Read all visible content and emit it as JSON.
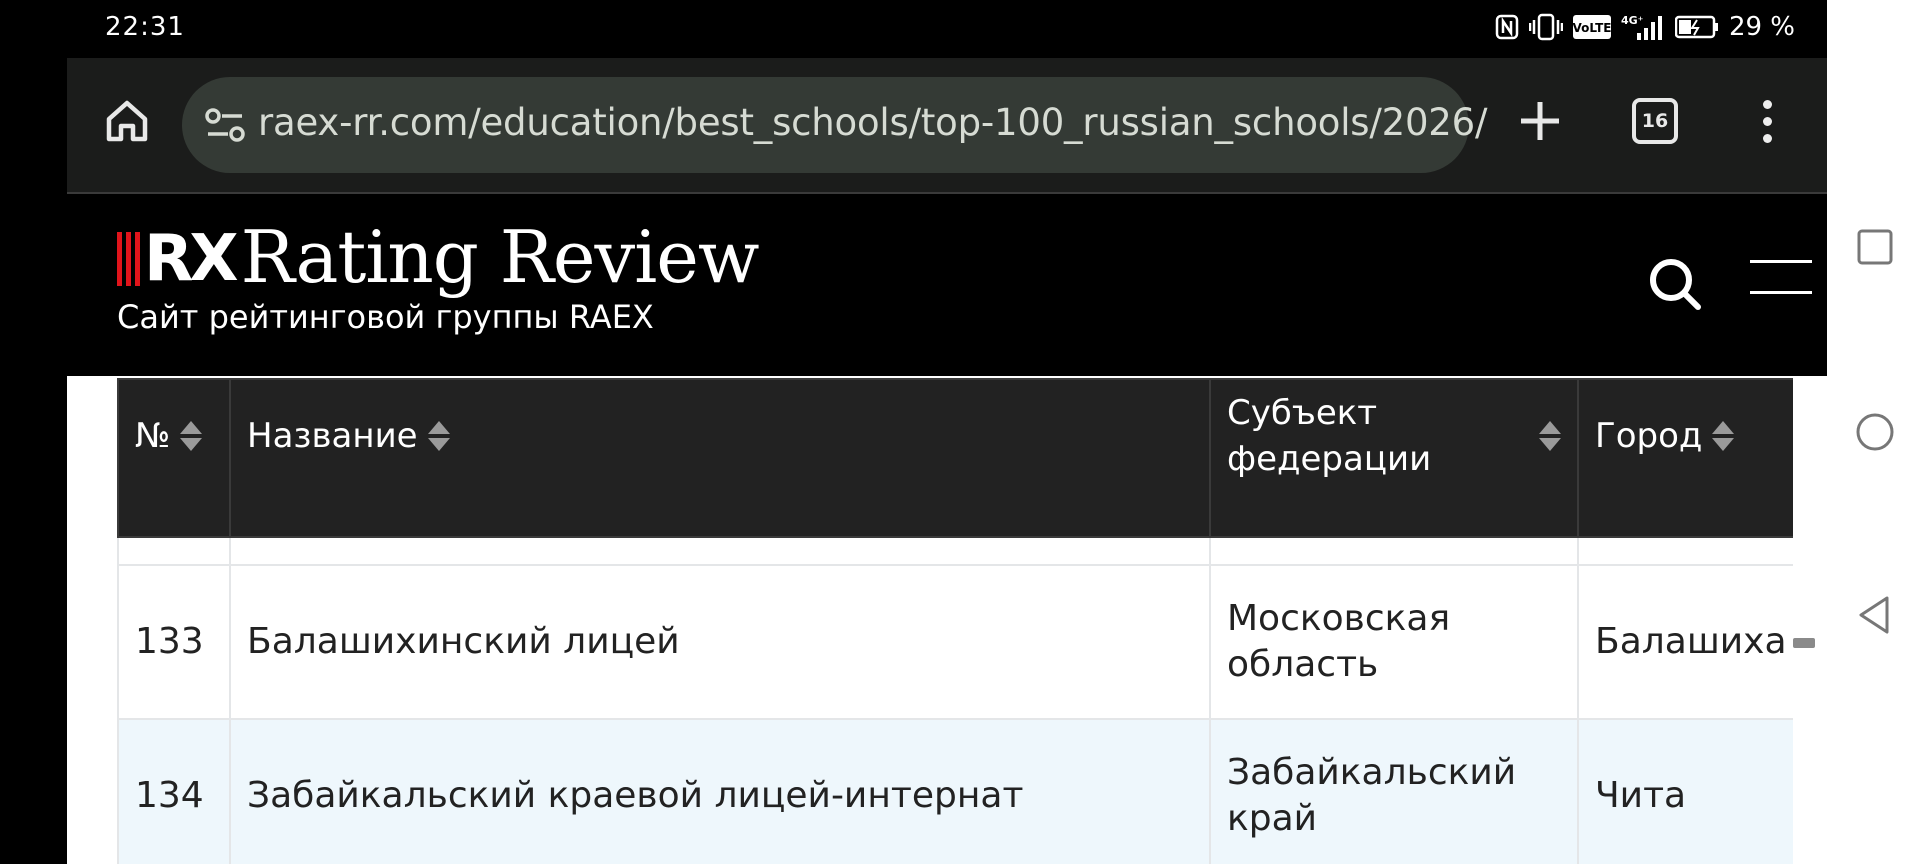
{
  "status_bar": {
    "time": "22:31",
    "battery_percent": "29 %",
    "icons": [
      "nfc-icon",
      "vibrate-icon",
      "volte-icon",
      "signal-4g-icon",
      "battery-saver-icon"
    ],
    "volte_label": "VoLTE",
    "network_label": "4G⁺"
  },
  "browser": {
    "url": "raex-rr.com/education/best_schools/top-100_russian_schools/2026/",
    "tab_count": "16"
  },
  "site": {
    "logo_rx": "RX",
    "logo_title": "Rating Review",
    "subtitle": "Сайт рейтинговой группы RAEX",
    "brand_red": "#e1141b"
  },
  "table": {
    "columns": [
      "№",
      "Название",
      "Субъект федерации",
      "Город"
    ],
    "rows": [
      {
        "num": "133",
        "name": "Балашихинский лицей",
        "region": "Московская область",
        "city": "Балашиха"
      },
      {
        "num": "134",
        "name": "Забайкальский краевой лицей-интернат",
        "region": "Забайкальский край",
        "city": "Чита"
      }
    ],
    "alt_row_color": "#eef7fc",
    "header_color": "#222222"
  }
}
